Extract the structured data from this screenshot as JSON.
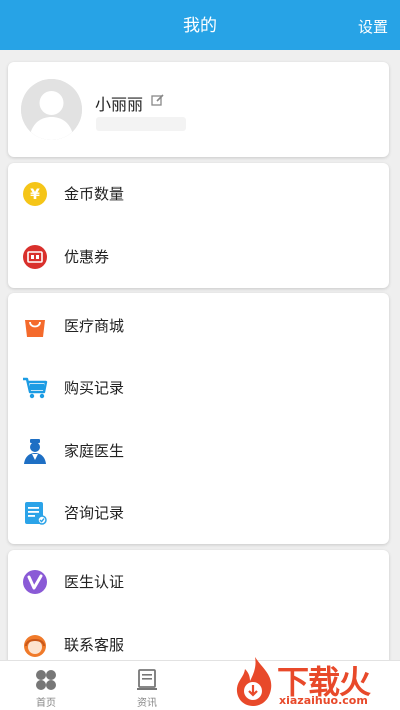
{
  "header": {
    "title": "我的",
    "settings_label": "设置",
    "bg_color": "#27a3e6"
  },
  "profile": {
    "username": "小丽丽",
    "avatar_icon": "default-avatar-icon",
    "edit_icon": "edit-icon"
  },
  "wallet": {
    "items": [
      {
        "label": "金币数量",
        "icon": "gold-coin-icon",
        "color": "#f5c518"
      },
      {
        "label": "优惠券",
        "icon": "coupon-icon",
        "color": "#d9302c"
      }
    ]
  },
  "services": {
    "items": [
      {
        "label": "医疗商城",
        "icon": "shopping-bag-icon",
        "color": "#f46a2c"
      },
      {
        "label": "购买记录",
        "icon": "shopping-cart-icon",
        "color": "#1c9ce4"
      },
      {
        "label": "家庭医生",
        "icon": "doctor-icon",
        "color": "#1e6fc4"
      },
      {
        "label": "咨询记录",
        "icon": "consultation-record-icon",
        "color": "#2ba3e8"
      }
    ]
  },
  "more": {
    "items": [
      {
        "label": "医生认证",
        "icon": "verify-v-icon",
        "color": "#8a5ad6"
      },
      {
        "label": "联系客服",
        "icon": "customer-service-icon",
        "color": "#f07a2a"
      }
    ]
  },
  "bottom_nav": {
    "items": [
      {
        "label": "首页",
        "icon": "home-grid-icon"
      },
      {
        "label": "资讯",
        "icon": "news-icon"
      }
    ]
  },
  "watermark": {
    "text": "下载火",
    "url": "xiazaihuo.com"
  }
}
